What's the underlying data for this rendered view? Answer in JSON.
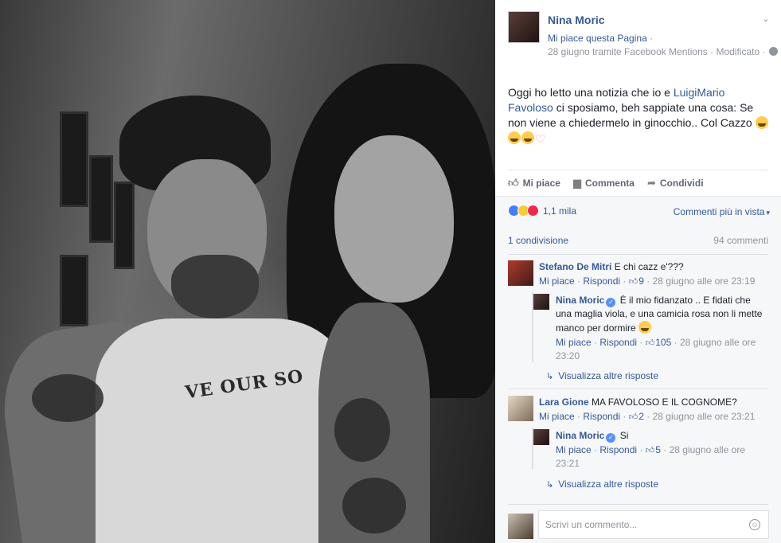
{
  "post": {
    "author": "Nina Moric",
    "page_like": "Mi piace questa Pagina",
    "date_line": "28 giugno tramite Facebook Mentions · Modificato ·",
    "text_before": "Oggi ho letto una notizia che io e ",
    "mention": "LuigiMario Favoloso",
    "text_after": " ci sposiamo, beh sappiate una cosa: Se non viene a chiedermelo in ginocchio.. Col Cazzo "
  },
  "photo": {
    "tattoo_text": "VE OUR SO"
  },
  "actions": {
    "like": "Mi piace",
    "comment": "Commenta",
    "share": "Condividi"
  },
  "feedback": {
    "reactions_count": "1,1 mila",
    "order_label": "Commenti più in vista",
    "shares": "1 condivisione",
    "comments": "94 commenti"
  },
  "comments": [
    {
      "name": "Stefano De Mitri",
      "text": "E chi cazz e'???",
      "like_label": "Mi piace",
      "reply_label": "Rispondi",
      "likes": "9",
      "time": "28 giugno alle ore 23:19",
      "reply": {
        "name": "Nina Moric",
        "text": "È il mio fidanzato .. E fidati che una maglia viola, e una camicia rosa non li mette manco per dormire",
        "like_label": "Mi piace",
        "reply_label": "Rispondi",
        "likes": "105",
        "time": "28 giugno alle ore 23:20"
      },
      "more": "Visualizza altre risposte"
    },
    {
      "name": "Lara Gione",
      "text": "MA FAVOLOSO E IL COGNOME?",
      "like_label": "Mi piace",
      "reply_label": "Rispondi",
      "likes": "2",
      "time": "28 giugno alle ore 23:21",
      "reply": {
        "name": "Nina Moric",
        "text": "Si",
        "like_label": "Mi piace",
        "reply_label": "Rispondi",
        "likes": "5",
        "time": "28 giugno alle ore 23:21"
      },
      "more": "Visualizza altre risposte"
    }
  ],
  "composer": {
    "placeholder": "Scrivi un commento..."
  },
  "colors": {
    "link": "#365899",
    "muted": "#90949c",
    "feedback_bg": "#f6f7f9"
  },
  "icons": [
    "globe-icon",
    "chevron-down-icon",
    "like-icon",
    "comment-icon",
    "share-icon",
    "thumb-icon",
    "verified-icon",
    "reply-arrow-icon",
    "smiley-icon"
  ]
}
